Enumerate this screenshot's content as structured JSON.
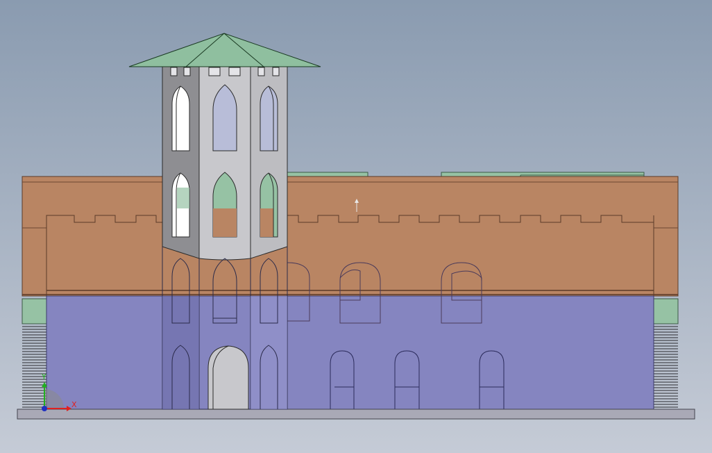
{
  "scene": {
    "background_top": "#8a9bb0",
    "background_bottom": "#c5cbd6",
    "colors": {
      "roof": "#8fbf9f",
      "tower_light": "#c8c8cc",
      "tower_mid": "#b3b3b8",
      "tower_dark": "#8e8e92",
      "upper_wall": "#b98563",
      "lower_wall": "#8585c0",
      "base_slab": "#a9a9b6",
      "edge": "#3a2a20",
      "green_box": "#96c2a4",
      "window_glass": "#b8bdd8",
      "axis_x": "#e02020",
      "axis_y": "#20b020",
      "axis_origin": "#2030c0"
    }
  },
  "axes": {
    "x_label": "X",
    "y_label": "Y"
  }
}
